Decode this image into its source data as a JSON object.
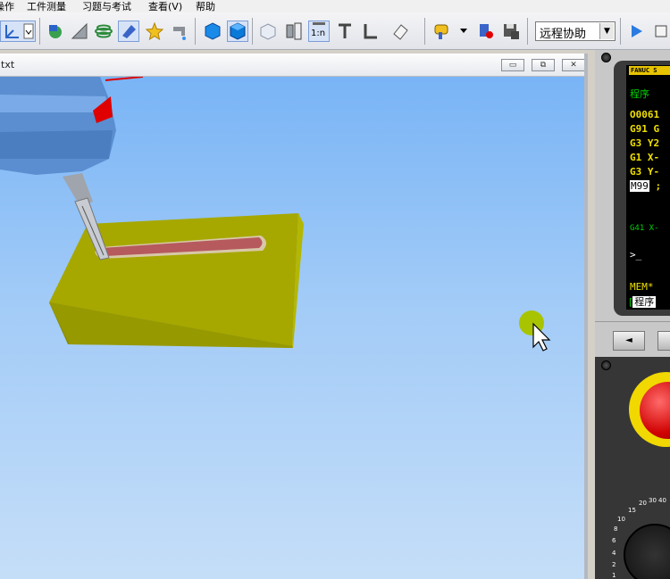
{
  "menu": {
    "items": [
      "操作",
      "工件测量",
      "习题与考试",
      "查看(V)",
      "帮助"
    ]
  },
  "toolbar": {
    "icons": [
      "coordinate-icon",
      "camera-icon",
      "ruler-icon",
      "spiral-icon",
      "select-icon",
      "star-icon",
      "faucet-icon",
      "cube-solid-icon",
      "cube-outline-icon",
      "cube-wire-icon",
      "tool-holder-icon",
      "tool-length-icon",
      "tool-t-icon",
      "tool-l-icon",
      "erase-icon",
      "doorbell-icon",
      "record-icon",
      "save-icon",
      "play-icon",
      "stop-icon"
    ],
    "remote_combo_value": "远程协助"
  },
  "viewport": {
    "window_title": "txt",
    "minimize_label": "▭",
    "restore_label": "⧉",
    "close_label": "✕"
  },
  "cnc_panel": {
    "brand_label": "FANUC S",
    "screen_title": "程序",
    "program_lines": [
      "O0061",
      "G91 G",
      "G3 Y2",
      "G1 X-",
      "G3 Y-"
    ],
    "cursor_line": "M99",
    "cursor_line_suffix": " ;",
    "modal_text": "G41 X-",
    "prompt": ">_",
    "mode_text": "MEM*",
    "softkey_label": "程序",
    "soft_left_label": "◄",
    "dial_ticks": [
      "1",
      "2",
      "4",
      "6",
      "8",
      "10",
      "15",
      "20",
      "30",
      "40"
    ]
  },
  "colors": {
    "workpiece": "#a6a800",
    "slot": "#b65a5e",
    "spindle": "#5a8ed0",
    "sky_top": "#79b4f6",
    "estop": "#d00000"
  }
}
